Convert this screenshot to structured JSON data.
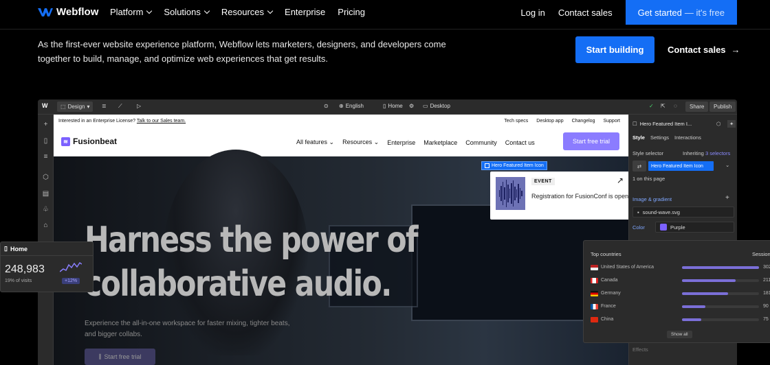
{
  "nav": {
    "brand": "Webflow",
    "links": [
      {
        "label": "Platform",
        "dropdown": true
      },
      {
        "label": "Solutions",
        "dropdown": true
      },
      {
        "label": "Resources",
        "dropdown": true
      },
      {
        "label": "Enterprise",
        "dropdown": false
      },
      {
        "label": "Pricing",
        "dropdown": false
      }
    ],
    "login": "Log in",
    "contact_sales": "Contact sales",
    "get_started": "Get started",
    "get_started_suffix": "— it's free"
  },
  "hero": {
    "description": "As the first-ever website experience platform, Webflow lets marketers, designers, and developers come together to build, manage, and optimize web experiences that get results.",
    "start_building": "Start building",
    "contact_sales": "Contact sales"
  },
  "designer": {
    "toolbar": {
      "mode": "Design",
      "locale": "English",
      "page": "Home",
      "breakpoint": "Desktop",
      "share": "Share",
      "publish": "Publish"
    },
    "site": {
      "enterprise_text": "Interested in an Enterprise License?",
      "enterprise_link": "Talk to our Sales team.",
      "top_links": [
        "Tech specs",
        "Desktop app",
        "Changelog",
        "Support"
      ],
      "brand": "Fusionbeat",
      "nav_links": [
        {
          "label": "All features",
          "dropdown": true
        },
        {
          "label": "Resources",
          "dropdown": true
        },
        {
          "label": "Enterprise",
          "dropdown": false
        },
        {
          "label": "Marketplace",
          "dropdown": false
        },
        {
          "label": "Community",
          "dropdown": false
        },
        {
          "label": "Contact us",
          "dropdown": false
        }
      ],
      "trial_button": "Start free trial",
      "headline_line1": "Harness the power of",
      "headline_line2": "collaborative audio.",
      "subheadline": "Experience the all-in-one workspace for faster mixing, tighter beats, and bigger collabs.",
      "hero_button": "Start free trial",
      "featured_label": "Hero Featured Item Icon",
      "featured_tag": "EVENT",
      "featured_text": "Registration for FusionConf is open"
    },
    "panel": {
      "element": "Hero Featured Item I...",
      "tabs": [
        "Style",
        "Settings",
        "Interactions"
      ],
      "style_selector": "Style selector",
      "inheriting": "Inheriting",
      "inheriting_count": "3 selectors",
      "selector_pill": "Hero Featured Item Icon",
      "on_page": "1 on this page",
      "image_gradient": "Image & gradient",
      "image_file": "sound-wave.svg",
      "color_label": "Color",
      "color_value": "Purple",
      "effects": "Effects",
      "accent": "#7b61ff"
    }
  },
  "home_card": {
    "title": "Home",
    "value": "248,983",
    "label": "19% of visits",
    "delta": "+12%"
  },
  "countries_card": {
    "title": "Top countries",
    "column": "Sessions",
    "rows": [
      {
        "name": "United States of America",
        "value": "302",
        "fraction": 1.0,
        "flag": "us-flag-icon"
      },
      {
        "name": "Canada",
        "value": "211",
        "fraction": 0.7,
        "flag": "canada-flag-icon"
      },
      {
        "name": "Germany",
        "value": "181",
        "fraction": 0.6,
        "flag": "germany-flag-icon"
      },
      {
        "name": "France",
        "value": "90",
        "fraction": 0.3,
        "flag": "france-flag-icon"
      },
      {
        "name": "China",
        "value": "75",
        "fraction": 0.25,
        "flag": "china-flag-icon"
      }
    ],
    "show_all": "Show all"
  }
}
